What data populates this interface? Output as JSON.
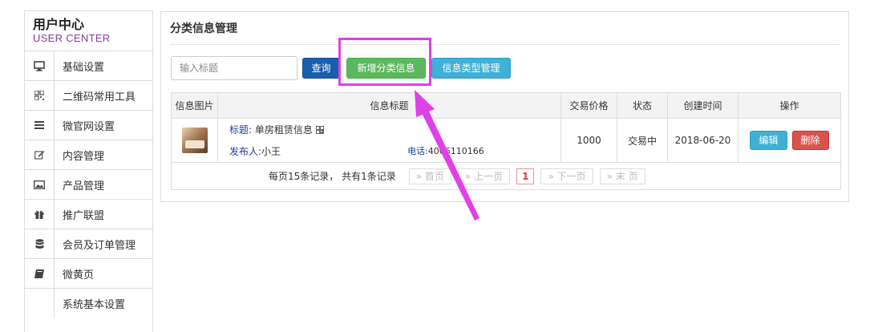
{
  "sidebar": {
    "title": "用户中心",
    "subtitle": "USER CENTER",
    "items": [
      {
        "label": "基础设置",
        "icon": "monitor-icon"
      },
      {
        "label": "二维码常用工具",
        "icon": "qrcode-icon"
      },
      {
        "label": "微官网设置",
        "icon": "list-icon"
      },
      {
        "label": "内容管理",
        "icon": "edit-icon"
      },
      {
        "label": "产品管理",
        "icon": "image-icon"
      },
      {
        "label": "推广联盟",
        "icon": "gift-icon"
      },
      {
        "label": "会员及订单管理",
        "icon": "database-icon"
      },
      {
        "label": "微黄页",
        "icon": "book-icon"
      },
      {
        "label": "系统基本设置",
        "icon": ""
      }
    ]
  },
  "panel": {
    "title": "分类信息管理",
    "search_placeholder": "输入标题",
    "query_label": "查询",
    "add_label": "新增分类信息",
    "type_label": "信息类型管理"
  },
  "table": {
    "headers": [
      "信息图片",
      "信息标题",
      "交易价格",
      "状态",
      "创建时间",
      "操作"
    ],
    "rows": [
      {
        "title_label": "标题:",
        "title": "单房租赁信息",
        "publisher_label": "发布人:",
        "publisher": "小王",
        "phone_label": "电话:",
        "phone": "4006110166",
        "price": "1000",
        "status": "交易中",
        "created": "2018-06-20",
        "edit_label": "编辑",
        "delete_label": "删除"
      }
    ]
  },
  "pager": {
    "summary": "每页15条记录，  共有1条记录",
    "first": "» 首页",
    "prev": "» 上一页",
    "current": "1",
    "next": "» 下一页",
    "last": "» 末  页"
  },
  "annotation": {
    "color": "#e040e8"
  }
}
